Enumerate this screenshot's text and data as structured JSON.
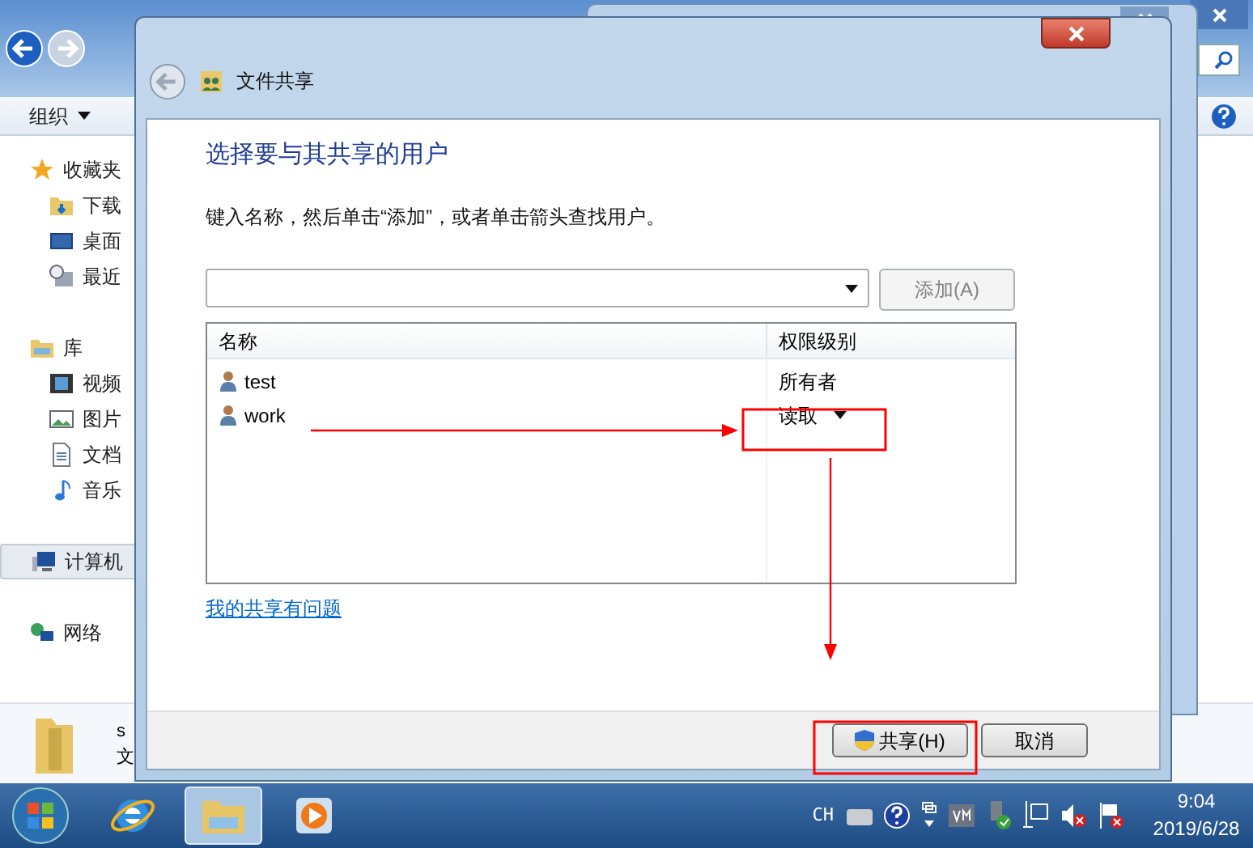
{
  "explorer": {
    "toolbar": {
      "organize": "组织"
    },
    "sidebar": [
      {
        "label": "收藏夹",
        "kind": "favorites",
        "selected": false,
        "children": [
          {
            "label": "下载",
            "kind": "download",
            "selected": false
          },
          {
            "label": "桌面",
            "kind": "desktop",
            "selected": false
          },
          {
            "label": "最近",
            "kind": "recent",
            "selected": false
          }
        ]
      },
      {
        "label": "库",
        "kind": "library",
        "selected": false,
        "children": [
          {
            "label": "视频",
            "kind": "video",
            "selected": false
          },
          {
            "label": "图片",
            "kind": "picture",
            "selected": false
          },
          {
            "label": "文档",
            "kind": "document",
            "selected": false
          },
          {
            "label": "音乐",
            "kind": "music",
            "selected": false
          }
        ]
      },
      {
        "label": "计算机",
        "kind": "computer",
        "selected": true
      },
      {
        "label": "网络",
        "kind": "network",
        "selected": false
      }
    ],
    "details": [
      "s",
      "文"
    ]
  },
  "dialog": {
    "title": "文件共享",
    "heading": "选择要与其共享的用户",
    "instruction": "键入名称，然后单击“添加”，或者单击箭头查找用户。",
    "add_button": {
      "label": "添加(A)",
      "disabled": true
    },
    "table": {
      "columns": [
        "名称",
        "权限级别"
      ],
      "rows": [
        {
          "name": "test",
          "permission": "所有者",
          "kind": "fixed"
        },
        {
          "name": "work",
          "permission": "读取",
          "kind": "dropdown"
        }
      ]
    },
    "link": "我的共享有问题",
    "buttons": [
      {
        "label": "共享(H)",
        "kind": "shield"
      },
      {
        "label": "取消",
        "kind": "plain"
      }
    ]
  },
  "taskbar": {
    "apps": [
      {
        "kind": "browser",
        "selected": false
      },
      {
        "kind": "folder",
        "selected": true
      },
      {
        "kind": "media",
        "selected": false
      }
    ],
    "tray": {
      "ime": "CH"
    },
    "clock": {
      "time": "9:04",
      "date": "2019/6/28"
    }
  }
}
